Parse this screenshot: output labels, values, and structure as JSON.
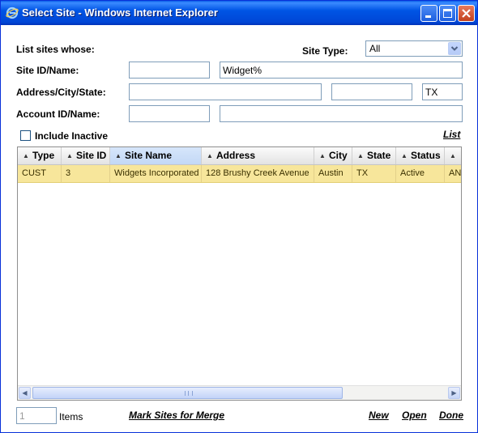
{
  "window": {
    "title": "Select Site - Windows Internet Explorer"
  },
  "form": {
    "list_sites_label": "List sites whose:",
    "site_type_label": "Site Type:",
    "site_type_value": "All",
    "site_id_label": "Site ID/Name:",
    "site_id_value": "",
    "site_name_value": "Widget%",
    "address_label": "Address/City/State:",
    "address_value": "",
    "city_value": "",
    "state_value": "TX",
    "account_label": "Account ID/Name:",
    "account_id_value": "",
    "account_name_value": "",
    "include_inactive_label": "Include Inactive",
    "include_inactive_checked": false,
    "list_link": "List"
  },
  "grid": {
    "columns": [
      "Type",
      "Site ID",
      "Site Name",
      "Address",
      "City",
      "State",
      "Status",
      ""
    ],
    "sorted_column": "Site Name",
    "rows": [
      {
        "type": "CUST",
        "site_id": "3",
        "site_name": "Widgets Incorporated",
        "address": "128 Brushy Creek Avenue",
        "city": "Austin",
        "state": "TX",
        "status": "Active",
        "extra": "AN"
      }
    ]
  },
  "footer": {
    "items_count": "1",
    "items_label": "Items",
    "mark_merge_link": "Mark Sites for Merge",
    "new_link": "New",
    "open_link": "Open",
    "done_link": "Done"
  }
}
